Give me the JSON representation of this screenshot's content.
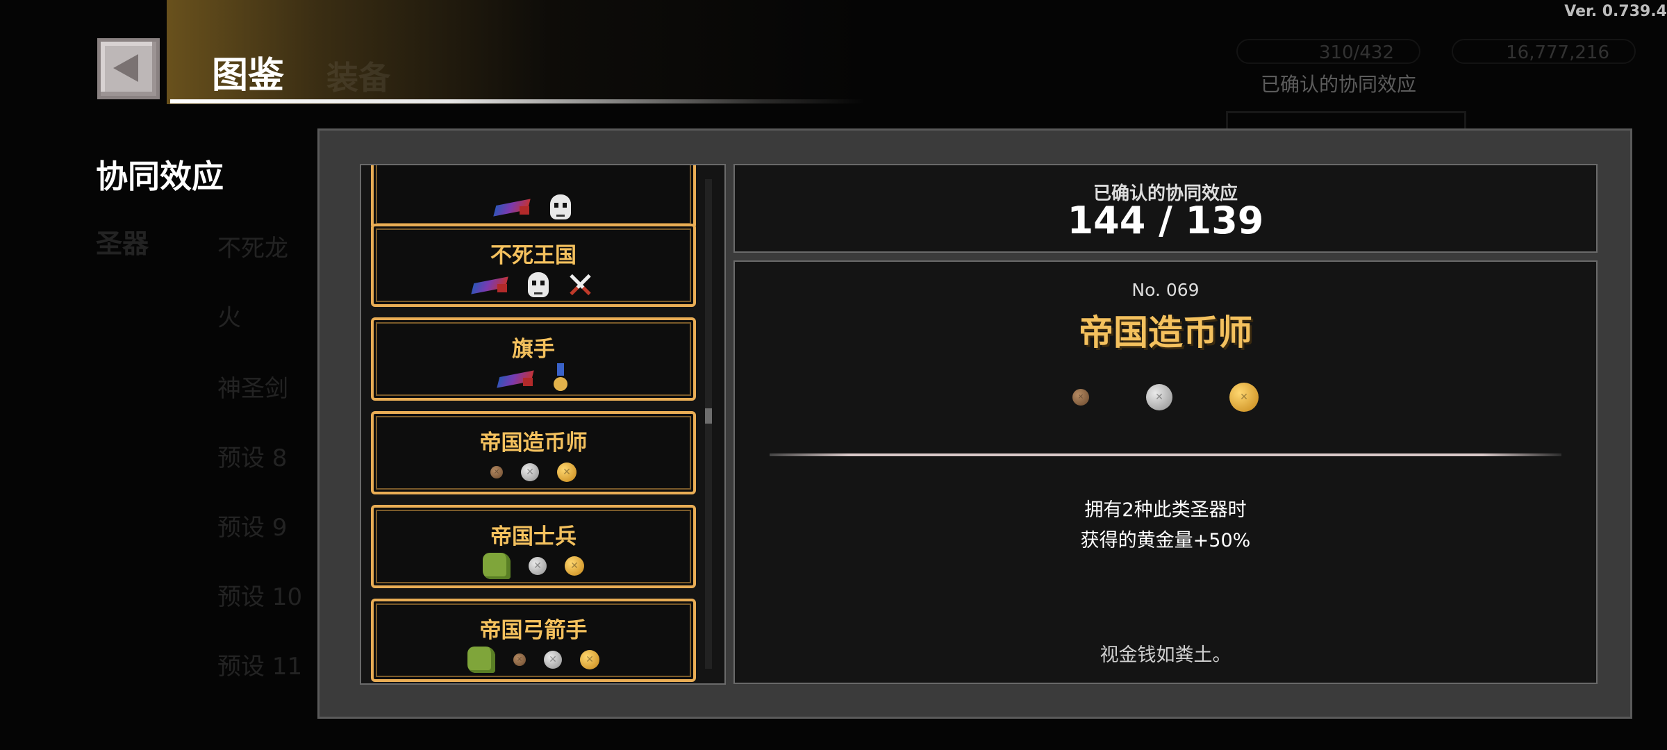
{
  "version": "Ver. 0.739.4",
  "header": {
    "title": "图鉴",
    "ghost_tab": "装备",
    "currency_1": "310/432",
    "currency_2": "16,777,216",
    "bg_confirm_label": "已确认的协同效应"
  },
  "side_menu": {
    "active_category": "协同效应",
    "inactive_category": "圣器",
    "items": [
      "不死龙",
      "火",
      "神圣剑",
      "预设 8",
      "预设 9",
      "预设 10",
      "预设 11"
    ]
  },
  "synergy_list": [
    {
      "name": "",
      "icons": [
        "bird-icon",
        "skull-icon"
      ]
    },
    {
      "name": "不死王国",
      "icons": [
        "bird-icon",
        "skull-icon",
        "crossed-swords-icon"
      ]
    },
    {
      "name": "旗手",
      "icons": [
        "bird-icon",
        "medal-icon"
      ]
    },
    {
      "name": "帝国造币师",
      "icons": [
        "bronze-coin-icon",
        "silver-coin-icon",
        "gold-coin-icon"
      ]
    },
    {
      "name": "帝国士兵",
      "icons": [
        "green-glove-icon",
        "silver-coin-icon",
        "gold-coin-icon"
      ]
    },
    {
      "name": "帝国弓箭手",
      "icons": [
        "green-glove-icon",
        "bronze-coin-icon",
        "silver-coin-icon",
        "gold-coin-icon"
      ]
    }
  ],
  "summary": {
    "label": "已确认的协同效应",
    "value": "144 / 139"
  },
  "detail": {
    "number": "No. 069",
    "title": "帝国造币师",
    "icons": [
      "bronze-coin-icon",
      "silver-coin-icon",
      "gold-coin-icon"
    ],
    "effect_line_1": "拥有2种此类圣器时",
    "effect_line_2": "获得的黄金量+50%",
    "flavor": "视金钱如粪土。"
  },
  "colors": {
    "accent_gold": "#f4c15e",
    "card_border": "#e9ad55",
    "modal_bg": "#3b3b3b",
    "panel_bg": "#141414"
  }
}
